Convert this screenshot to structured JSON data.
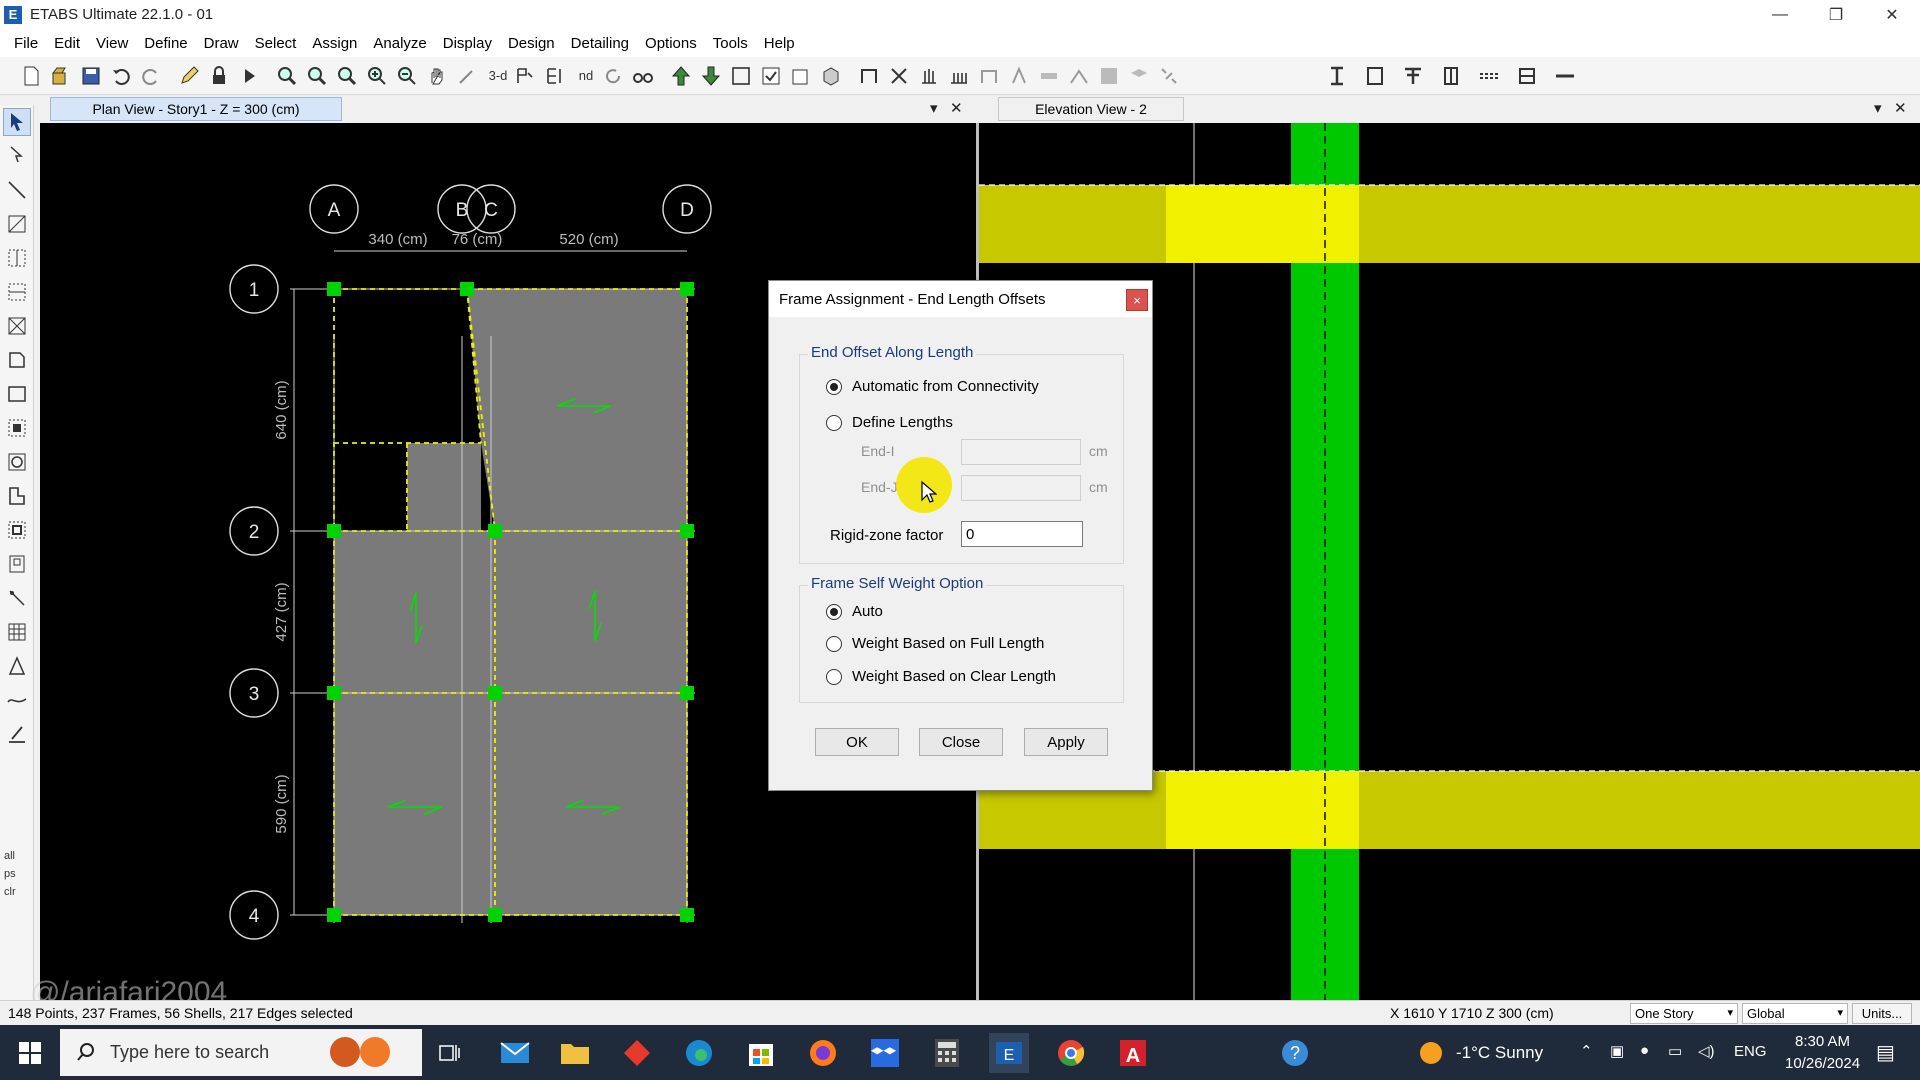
{
  "window": {
    "title": "ETABS Ultimate 22.1.0 - 01",
    "controls": [
      "—",
      "❐",
      "✕"
    ]
  },
  "menu": [
    "File",
    "Edit",
    "View",
    "Define",
    "Draw",
    "Select",
    "Assign",
    "Analyze",
    "Display",
    "Design",
    "Detailing",
    "Options",
    "Tools",
    "Help"
  ],
  "toolbar": {
    "text_3d": "3-d",
    "text_nd": "nd"
  },
  "left_tools_text": [
    "all",
    "ps",
    "clr"
  ],
  "tabs": {
    "plan": "Plan View - Story1 - Z = 300 (cm)",
    "elevation": "Elevation View - 2"
  },
  "plan_view": {
    "grid_columns": [
      "A",
      "B",
      "C",
      "D"
    ],
    "grid_rows": [
      "1",
      "2",
      "3",
      "4"
    ],
    "dims_x": [
      "340 (cm)",
      "76 (cm)",
      "520 (cm)"
    ],
    "dims_y": [
      "640 (cm)",
      "427 (cm)",
      "590 (cm)"
    ]
  },
  "dialog": {
    "title": "Frame Assignment - End Length Offsets",
    "close": "×",
    "group1_title": "End Offset Along Length",
    "opt_auto": "Automatic from Connectivity",
    "opt_define": "Define Lengths",
    "end_i_label": "End-I",
    "end_j_label": "End-J",
    "end_i_value": "",
    "end_j_value": "",
    "unit": "cm",
    "rigid_label": "Rigid-zone factor",
    "rigid_value": "0",
    "group2_title": "Frame Self Weight Option",
    "opt_sw_auto": "Auto",
    "opt_sw_full": "Weight Based on Full Length",
    "opt_sw_clear": "Weight Based on Clear Length",
    "ok": "OK",
    "close_btn": "Close",
    "apply": "Apply",
    "selected_offset": "Automatic from Connectivity",
    "selected_weight": "Auto"
  },
  "status": {
    "selection": "148 Points, 237 Frames, 56 Shells, 217 Edges selected",
    "coords": "X 1610  Y 1710  Z 300 (cm)",
    "story": "One Story",
    "coord_sys": "Global",
    "units": "Units..."
  },
  "watermark": "@/ariafari2004",
  "taskbar": {
    "search_placeholder": "Type here to search",
    "weather": "-1°C  Sunny",
    "lang": "ENG",
    "time": "8:30 AM",
    "date": "10/26/2024"
  },
  "colors": {
    "accent": "#d6e5f7",
    "view_bg": "#000000",
    "grid_line": "#ffffff",
    "shell": "#7a7a7a",
    "selected": "#f0f000",
    "joint": "#00e000",
    "column": "#00c800",
    "beam": "#c8c800",
    "beam_highlight": "#f0f000",
    "cursor_highlight": "#f4e600"
  }
}
